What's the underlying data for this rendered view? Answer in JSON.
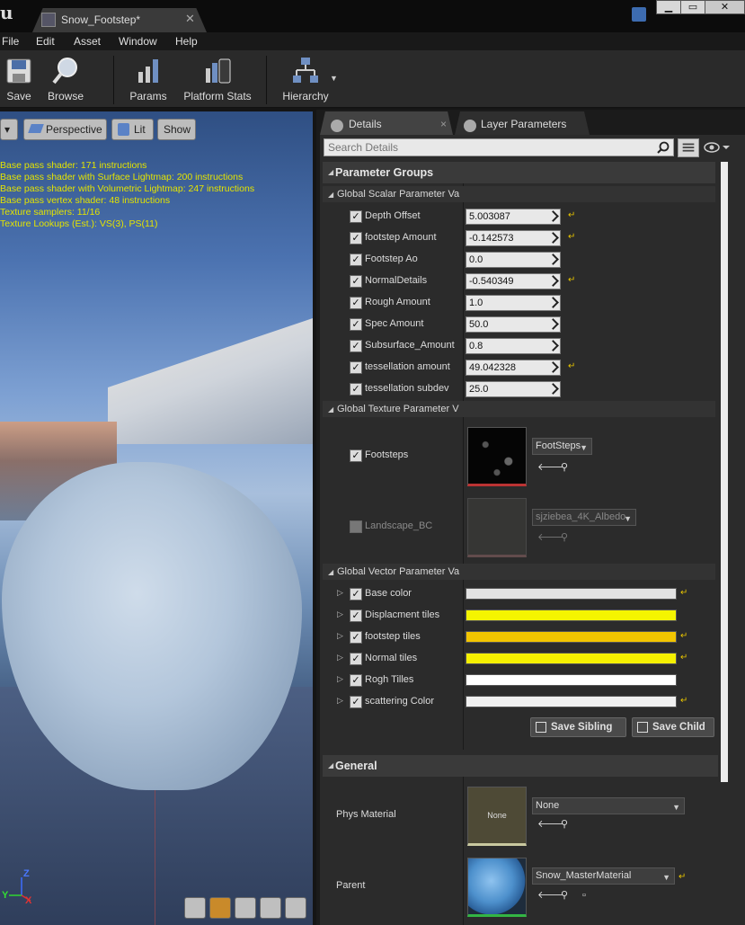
{
  "window": {
    "doc_tab": "Snow_Footstep*",
    "minimize": "▁",
    "maximize": "▭",
    "close": "✕"
  },
  "menu": [
    "File",
    "Edit",
    "Asset",
    "Window",
    "Help"
  ],
  "toolbar": {
    "save": "Save",
    "browse": "Browse",
    "params": "Params",
    "platform_stats": "Platform Stats",
    "hierarchy": "Hierarchy"
  },
  "viewport": {
    "perspective": "Perspective",
    "lit": "Lit",
    "show": "Show",
    "stats": [
      "Base pass shader: 171 instructions",
      "Base pass shader with Surface Lightmap: 200 instructions",
      "Base pass shader with Volumetric Lightmap: 247 instructions",
      "Base pass vertex shader: 48 instructions",
      "Texture samplers: 11/16",
      "Texture Lookups (Est.): VS(3), PS(11)"
    ],
    "axis": {
      "z": "Z",
      "y": "Y",
      "x": "X"
    }
  },
  "panel_tabs": {
    "details": "Details",
    "layer_parameters": "Layer Parameters",
    "close": "×"
  },
  "search": {
    "placeholder": "Search Details"
  },
  "parameter_groups": {
    "title": "Parameter Groups",
    "scalar_header": "Global Scalar Parameter Va",
    "scalars": [
      {
        "name": "Depth Offset",
        "value": "5.003087",
        "overridden": true
      },
      {
        "name": "footstep Amount",
        "value": "-0.142573",
        "overridden": true
      },
      {
        "name": "Footstep Ao",
        "value": "0.0",
        "overridden": false
      },
      {
        "name": "NormalDetails",
        "value": "-0.540349",
        "overridden": true
      },
      {
        "name": "Rough Amount",
        "value": "1.0",
        "overridden": false
      },
      {
        "name": "Spec Amount",
        "value": "50.0",
        "overridden": false
      },
      {
        "name": "Subsurface_Amount",
        "value": "0.8",
        "overridden": false
      },
      {
        "name": "tessellation amount",
        "value": "49.042328",
        "overridden": true
      },
      {
        "name": "tessellation subdev",
        "value": "25.0",
        "overridden": false
      }
    ],
    "texture_header": "Global Texture Parameter V",
    "textures": [
      {
        "name": "Footsteps",
        "asset": "FootSteps",
        "enabled": true
      },
      {
        "name": "Landscape_BC",
        "asset": "sjziebea_4K_Albedo",
        "enabled": false
      }
    ],
    "vector_header": "Global Vector Parameter Va",
    "vectors": [
      {
        "name": "Base color",
        "color": "#e2e2e2",
        "overridden": true
      },
      {
        "name": "Displacment tiles",
        "color": "#f5f500",
        "overridden": false
      },
      {
        "name": "footstep tiles",
        "color": "#f2c500",
        "overridden": true
      },
      {
        "name": "Normal tiles",
        "color": "#f5f000",
        "overridden": true
      },
      {
        "name": "Rogh Tilles",
        "color": "#ffffff",
        "overridden": false
      },
      {
        "name": "scattering Color",
        "color": "#f0f0f0",
        "overridden": true
      }
    ],
    "save_sibling": "Save Sibling",
    "save_child": "Save Child"
  },
  "general": {
    "title": "General",
    "phys_material_label": "Phys Material",
    "phys_material_value": "None",
    "phys_thumb_text": "None",
    "parent_label": "Parent",
    "parent_value": "Snow_MasterMaterial"
  },
  "colors": {
    "accent_yellow": "#e5c200",
    "panel_bg": "#2b2b2b"
  }
}
